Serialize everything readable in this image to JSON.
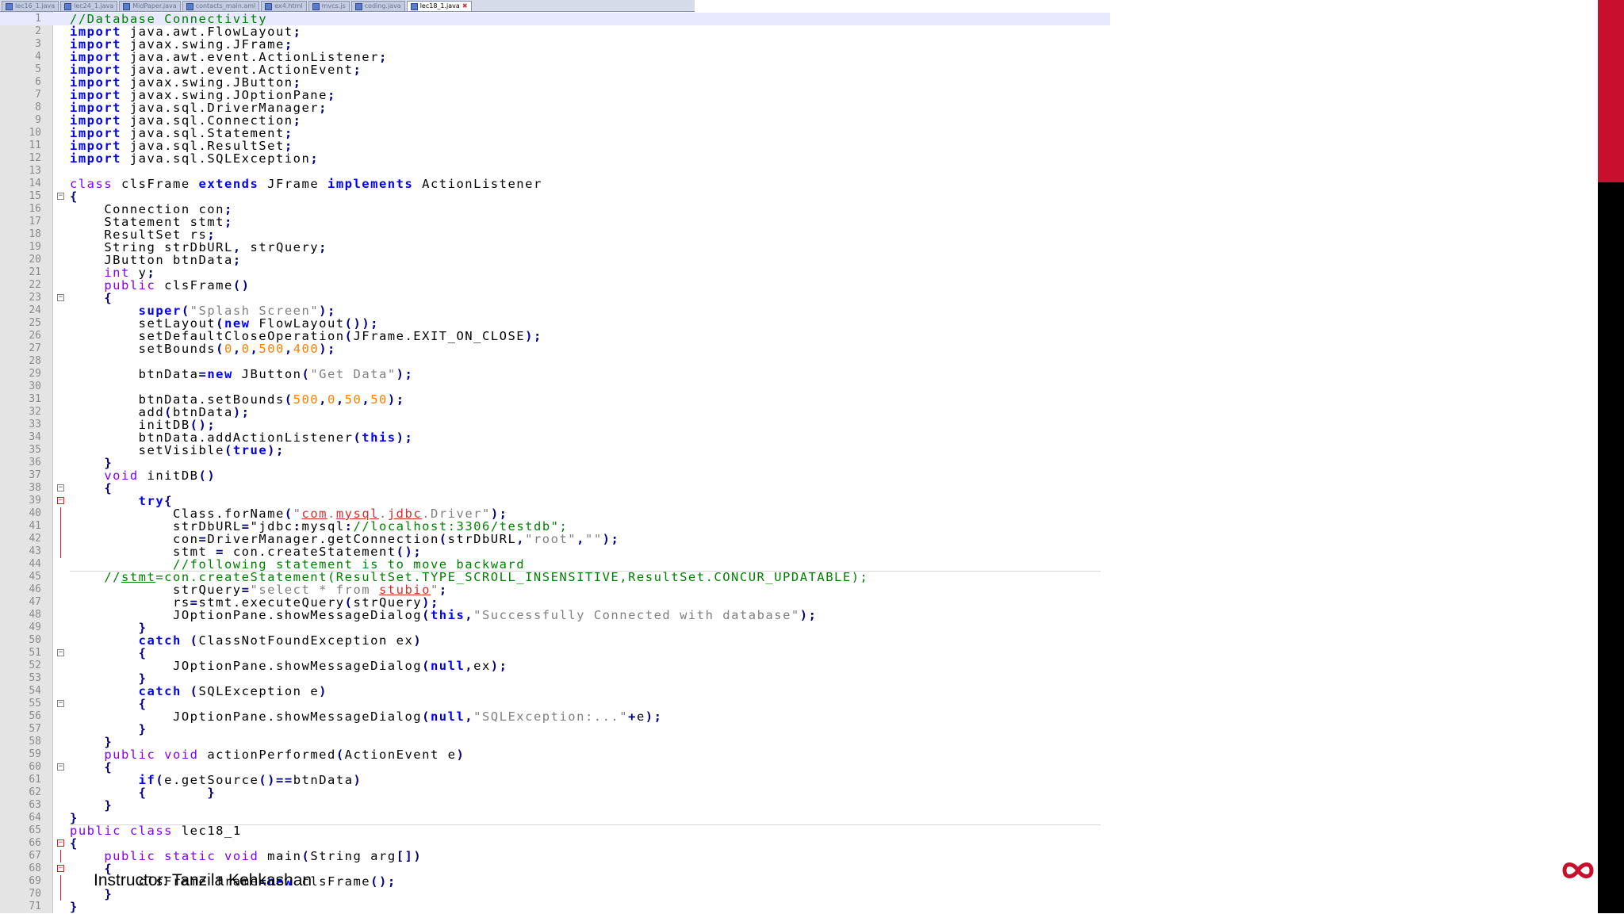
{
  "tabs": [
    {
      "label": "lec16_1.java",
      "active": false
    },
    {
      "label": "lec24_1.java",
      "active": false
    },
    {
      "label": "MidPaper.java",
      "active": false
    },
    {
      "label": "contacts_main.aml",
      "active": false
    },
    {
      "label": "ex4.html",
      "active": false
    },
    {
      "label": "mvcs.js",
      "active": false
    },
    {
      "label": "coding.java",
      "active": false
    },
    {
      "label": "lec18_1.java",
      "active": true
    }
  ],
  "current_line": 1,
  "code_lines": [
    {
      "n": "1",
      "t": "//Database Connectivity"
    },
    {
      "n": "2",
      "t": "import java.awt.FlowLayout;"
    },
    {
      "n": "3",
      "t": "import javax.swing.JFrame;"
    },
    {
      "n": "4",
      "t": "import java.awt.event.ActionListener;"
    },
    {
      "n": "5",
      "t": "import java.awt.event.ActionEvent;"
    },
    {
      "n": "6",
      "t": "import javax.swing.JButton;"
    },
    {
      "n": "7",
      "t": "import javax.swing.JOptionPane;"
    },
    {
      "n": "8",
      "t": "import java.sql.DriverManager;"
    },
    {
      "n": "9",
      "t": "import java.sql.Connection;"
    },
    {
      "n": "10",
      "t": "import java.sql.Statement;"
    },
    {
      "n": "11",
      "t": "import java.sql.ResultSet;"
    },
    {
      "n": "12",
      "t": "import java.sql.SQLException;"
    },
    {
      "n": "13",
      "t": ""
    },
    {
      "n": "14",
      "t": "class clsFrame extends JFrame implements ActionListener"
    },
    {
      "n": "15",
      "t": "{"
    },
    {
      "n": "16",
      "t": "    Connection con;"
    },
    {
      "n": "17",
      "t": "    Statement stmt;"
    },
    {
      "n": "18",
      "t": "    ResultSet rs;"
    },
    {
      "n": "19",
      "t": "    String strDbURL, strQuery;"
    },
    {
      "n": "20",
      "t": "    JButton btnData;"
    },
    {
      "n": "21",
      "t": "    int y;"
    },
    {
      "n": "22",
      "t": "    public clsFrame()"
    },
    {
      "n": "23",
      "t": "    {"
    },
    {
      "n": "24",
      "t": "        super(\"Splash Screen\");"
    },
    {
      "n": "25",
      "t": "        setLayout(new FlowLayout());"
    },
    {
      "n": "26",
      "t": "        setDefaultCloseOperation(JFrame.EXIT_ON_CLOSE);"
    },
    {
      "n": "27",
      "t": "        setBounds(0,0,500,400);"
    },
    {
      "n": "28",
      "t": ""
    },
    {
      "n": "29",
      "t": "        btnData=new JButton(\"Get Data\");"
    },
    {
      "n": "30",
      "t": ""
    },
    {
      "n": "31",
      "t": "        btnData.setBounds(500,0,50,50);"
    },
    {
      "n": "32",
      "t": "        add(btnData);"
    },
    {
      "n": "33",
      "t": "        initDB();"
    },
    {
      "n": "34",
      "t": "        btnData.addActionListener(this);"
    },
    {
      "n": "35",
      "t": "        setVisible(true);"
    },
    {
      "n": "36",
      "t": "    }"
    },
    {
      "n": "37",
      "t": "    void initDB()"
    },
    {
      "n": "38",
      "t": "    {"
    },
    {
      "n": "39",
      "t": "        try{"
    },
    {
      "n": "40",
      "t": "            Class.forName(\"com.mysql.jdbc.Driver\");"
    },
    {
      "n": "41",
      "t": "            strDbURL=\"jdbc:mysql://localhost:3306/testdb\";"
    },
    {
      "n": "42",
      "t": "            con=DriverManager.getConnection(strDbURL,\"root\",\"\");"
    },
    {
      "n": "43",
      "t": "            stmt = con.createStatement();"
    },
    {
      "n": "44",
      "t": "            //following statement is to move backward"
    },
    {
      "n": "45",
      "t": "    //stmt=con.createStatement(ResultSet.TYPE_SCROLL_INSENSITIVE,ResultSet.CONCUR_UPDATABLE);"
    },
    {
      "n": "46",
      "t": "            strQuery=\"select * from stubio\";"
    },
    {
      "n": "47",
      "t": "            rs=stmt.executeQuery(strQuery);"
    },
    {
      "n": "48",
      "t": "            JOptionPane.showMessageDialog(this,\"Successfully Connected with database\");"
    },
    {
      "n": "49",
      "t": "        }"
    },
    {
      "n": "50",
      "t": "        catch (ClassNotFoundException ex)"
    },
    {
      "n": "51",
      "t": "        {"
    },
    {
      "n": "52",
      "t": "            JOptionPane.showMessageDialog(null,ex);"
    },
    {
      "n": "53",
      "t": "        }"
    },
    {
      "n": "54",
      "t": "        catch (SQLException e)"
    },
    {
      "n": "55",
      "t": "        {"
    },
    {
      "n": "56",
      "t": "            JOptionPane.showMessageDialog(null,\"SQLException:...\"+e);"
    },
    {
      "n": "57",
      "t": "        }"
    },
    {
      "n": "58",
      "t": "    }"
    },
    {
      "n": "59",
      "t": "    public void actionPerformed(ActionEvent e)"
    },
    {
      "n": "60",
      "t": "    {"
    },
    {
      "n": "61",
      "t": "        if(e.getSource()==btnData)"
    },
    {
      "n": "62",
      "t": "        {       }"
    },
    {
      "n": "63",
      "t": "    }"
    },
    {
      "n": "64",
      "t": "}"
    },
    {
      "n": "65",
      "t": "public class lec18_1"
    },
    {
      "n": "66",
      "t": "{"
    },
    {
      "n": "67",
      "t": "    public static void main(String arg[])"
    },
    {
      "n": "68",
      "t": "    {"
    },
    {
      "n": "69",
      "t": "        clsFrame frame=new clsFrame();"
    },
    {
      "n": "70",
      "t": "    }"
    },
    {
      "n": "71",
      "t": "}"
    }
  ],
  "caption": "Instructor: Tanzila Kehkashan",
  "colors": {
    "accent_bar": "#c8102e",
    "side_panel": "#000000",
    "keyword": "#0000ff",
    "type": "#8000ff",
    "string": "#808080",
    "number": "#ff8000",
    "comment": "#008000"
  },
  "icons": {
    "logo": "infinity-logo-icon",
    "fold": "fold-toggle-icon",
    "tab": "file-tab-icon"
  }
}
